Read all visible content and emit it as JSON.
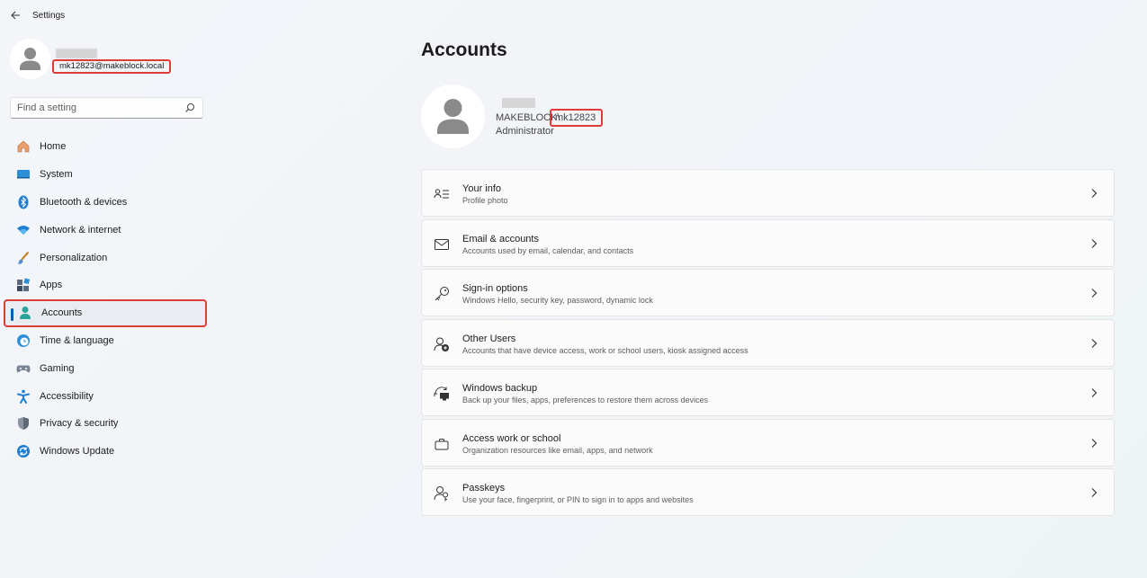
{
  "window": {
    "title": "Settings"
  },
  "sidebar": {
    "email": "mk12823@makeblock.local",
    "search_placeholder": "Find a setting",
    "items": [
      {
        "label": "Home",
        "icon": "home-icon"
      },
      {
        "label": "System",
        "icon": "system-icon"
      },
      {
        "label": "Bluetooth & devices",
        "icon": "bluetooth-icon"
      },
      {
        "label": "Network & internet",
        "icon": "network-icon"
      },
      {
        "label": "Personalization",
        "icon": "brush-icon"
      },
      {
        "label": "Apps",
        "icon": "apps-icon"
      },
      {
        "label": "Accounts",
        "icon": "accounts-icon",
        "active": true
      },
      {
        "label": "Time & language",
        "icon": "time-language-icon"
      },
      {
        "label": "Gaming",
        "icon": "gaming-icon"
      },
      {
        "label": "Accessibility",
        "icon": "accessibility-icon"
      },
      {
        "label": "Privacy & security",
        "icon": "shield-icon"
      },
      {
        "label": "Windows Update",
        "icon": "update-icon"
      }
    ]
  },
  "main": {
    "title": "Accounts",
    "domain": "MAKEBLOCK\\",
    "username": "mk12823",
    "role": "Administrator",
    "cards": [
      {
        "title": "Your info",
        "subtitle": "Profile photo",
        "icon": "your-info-icon"
      },
      {
        "title": "Email & accounts",
        "subtitle": "Accounts used by email, calendar, and contacts",
        "icon": "mail-icon"
      },
      {
        "title": "Sign-in options",
        "subtitle": "Windows Hello, security key, password, dynamic lock",
        "icon": "key-icon"
      },
      {
        "title": "Other Users",
        "subtitle": "Accounts that have device access, work or school users, kiosk assigned access",
        "icon": "add-user-icon"
      },
      {
        "title": "Windows backup",
        "subtitle": "Back up your files, apps, preferences to restore them across devices",
        "icon": "backup-icon"
      },
      {
        "title": "Access work or school",
        "subtitle": "Organization resources like email, apps, and network",
        "icon": "briefcase-icon"
      },
      {
        "title": "Passkeys",
        "subtitle": "Use your face, fingerprint, or PIN to sign in to apps and websites",
        "icon": "passkey-icon"
      }
    ]
  },
  "colors": {
    "accent": "#005fb8",
    "highlight": "#e03b3b"
  }
}
